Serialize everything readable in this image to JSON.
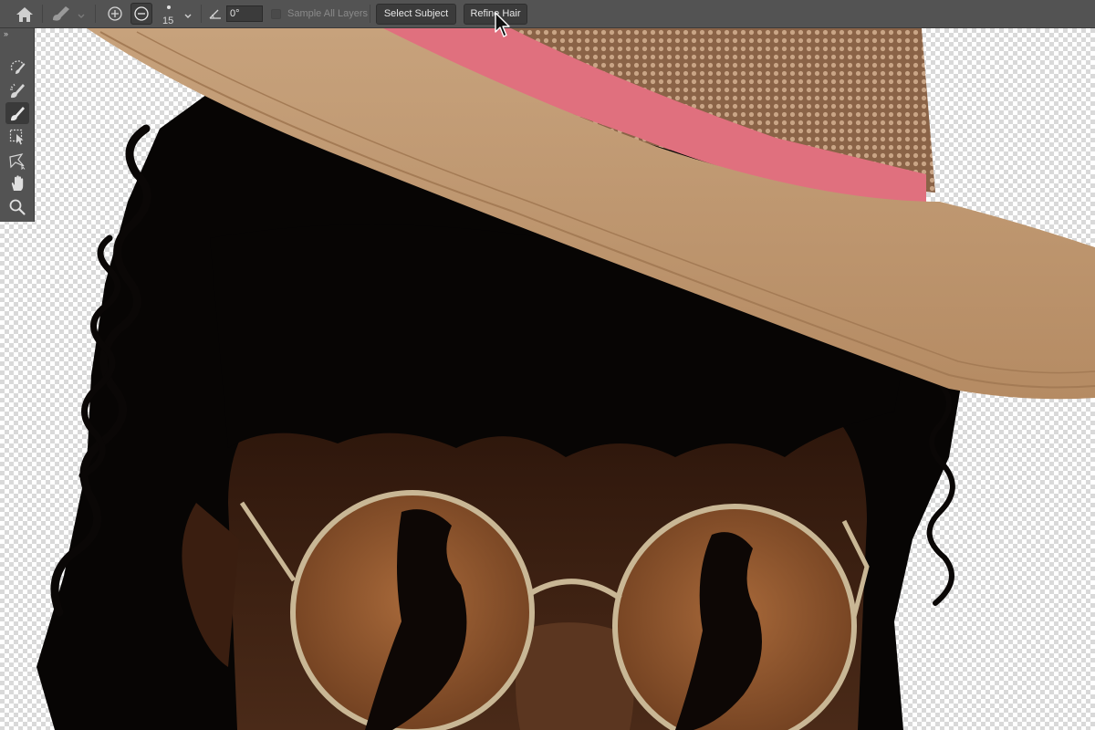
{
  "options_bar": {
    "icons": [
      "home-icon",
      "brush-preset-icon",
      "chevron-down-icon",
      "add-to-selection-icon",
      "subtract-from-selection-icon",
      "chevron-down-icon",
      "angle-icon"
    ],
    "brush_size": "15",
    "angle_value": "0°",
    "sample_all_layers_label": "Sample All Layers",
    "sample_all_layers_checked": false,
    "select_subject_label": "Select Subject",
    "refine_hair_label": "Refine Hair",
    "mode_selected": "subtract"
  },
  "toolbar": {
    "collapse_glyph": "››",
    "tools": [
      {
        "name": "quick-selection-tool",
        "icon": "quick-selection-icon",
        "active": false
      },
      {
        "name": "refine-edge-brush-tool",
        "icon": "refine-edge-brush-icon",
        "active": false
      },
      {
        "name": "brush-tool",
        "icon": "brush-icon",
        "active": true
      },
      {
        "name": "object-selection-tool",
        "icon": "object-selection-icon",
        "active": false
      },
      {
        "name": "lasso-tool",
        "icon": "lasso-icon",
        "active": false
      },
      {
        "name": "hand-tool",
        "icon": "hand-icon",
        "active": false
      },
      {
        "name": "zoom-tool",
        "icon": "zoom-icon",
        "active": false
      }
    ]
  },
  "colors": {
    "ui_panel": "#535353",
    "hat_straw": "#b7916c",
    "hat_band": "#e0707e",
    "hair": "#070504",
    "skin": "#3b2013",
    "lens": "#9a5c30",
    "frame": "#c9b795"
  }
}
